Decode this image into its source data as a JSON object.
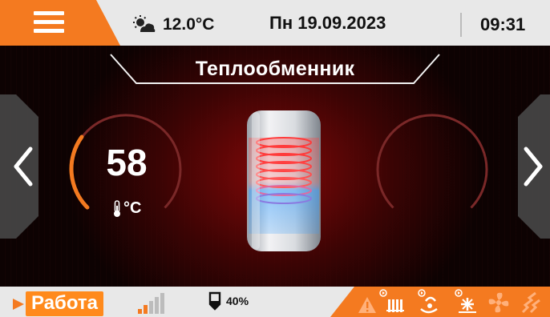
{
  "header": {
    "weather_icon": "partly-cloudy-icon",
    "outdoor_temp": "12.0°C",
    "date": "Пн 19.09.2023",
    "time": "09:31"
  },
  "screen_title": "Теплообменник",
  "left_gauge": {
    "value": "58",
    "unit": "°C",
    "icon": "thermometer-icon",
    "fill_fraction": 0.3
  },
  "right_gauge": {
    "fill_fraction": 0
  },
  "footer": {
    "status_label": "Работа",
    "fuel_icon": "fuel-level-icon",
    "fuel_level": "40%",
    "status_icons": [
      "warning-icon",
      "radiator-pump-icon",
      "hot-water-pump-icon",
      "floor-heating-pump-icon",
      "fan-icon",
      "feeder-icon"
    ]
  },
  "colors": {
    "accent": "#ff8a1c",
    "bar_bg": "#e8e8e8",
    "background": "#1a0303",
    "text_light": "#ffffff"
  }
}
